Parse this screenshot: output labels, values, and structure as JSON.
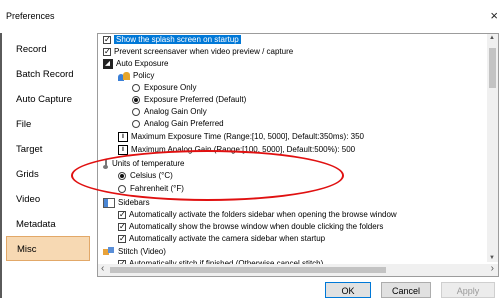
{
  "window": {
    "title": "Preferences",
    "close_glyph": "×"
  },
  "nav": [
    {
      "label": "Record",
      "active": false
    },
    {
      "label": "Batch Record",
      "active": false
    },
    {
      "label": "Auto Capture",
      "active": false
    },
    {
      "label": "File",
      "active": false
    },
    {
      "label": "Target",
      "active": false
    },
    {
      "label": "Grids",
      "active": false
    },
    {
      "label": "Video",
      "active": false
    },
    {
      "label": "Metadata",
      "active": false
    },
    {
      "label": "Misc",
      "active": true
    }
  ],
  "settings": {
    "splash": "Show the splash screen on startup",
    "screensaver": "Prevent screensaver when video preview / capture",
    "auto_exposure": "Auto Exposure",
    "policy": "Policy",
    "policy_options": [
      "Exposure Only",
      "Exposure Preferred (Default)",
      "Analog Gain Only",
      "Analog Gain Preferred"
    ],
    "max_exposure": "Maximum Exposure Time (Range:[10, 5000], Default:350ms): 350",
    "max_gain": "Maximum Analog Gain (Range:[100, 5000], Default:500%): 500",
    "temperature_units": "Units of temperature",
    "celsius": "Celsius (°C)",
    "fahrenheit": "Fahrenheit (°F)",
    "sidebars": "Sidebars",
    "sidebar_folders": "Automatically activate the folders sidebar when opening the browse window",
    "sidebar_browse": "Automatically show the browse window when double clicking the folders",
    "sidebar_camera": "Automatically activate the camera sidebar when startup",
    "stitch": "Stitch (Video)",
    "stitch_item": "Automatically stitch if finished (Otherwise cancel stitch)"
  },
  "buttons": {
    "ok": "OK",
    "cancel": "Cancel",
    "apply": "Apply"
  },
  "scroll_glyphs": {
    "left": "‹",
    "right": "›",
    "up": "▲",
    "down": "▼"
  },
  "colors": {
    "selection": "#0078d7",
    "active_nav": "#f7d9b3",
    "annotation": "#e01010"
  }
}
